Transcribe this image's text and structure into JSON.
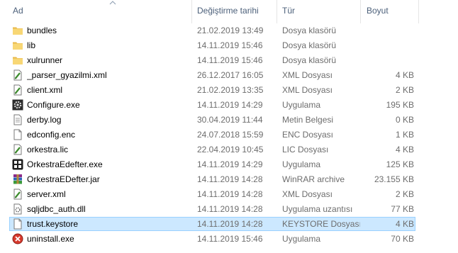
{
  "columns": {
    "name": "Ad",
    "date": "Değiştirme tarihi",
    "type": "Tür",
    "size": "Boyut"
  },
  "sort": {
    "column": "name",
    "direction": "ascending"
  },
  "files": [
    {
      "name": "bundles",
      "date": "21.02.2019 13:49",
      "type": "Dosya klasörü",
      "size": "",
      "icon": "folder-icon"
    },
    {
      "name": "lib",
      "date": "14.11.2019 15:46",
      "type": "Dosya klasörü",
      "size": "",
      "icon": "folder-icon"
    },
    {
      "name": "xulrunner",
      "date": "14.11.2019 15:46",
      "type": "Dosya klasörü",
      "size": "",
      "icon": "folder-icon"
    },
    {
      "name": "_parser_gyazilmi.xml",
      "date": "26.12.2017 16:05",
      "type": "XML Dosyası",
      "size": "4 KB",
      "icon": "xml-file-icon"
    },
    {
      "name": "client.xml",
      "date": "21.02.2019 13:35",
      "type": "XML Dosyası",
      "size": "2 KB",
      "icon": "xml-file-icon"
    },
    {
      "name": "Configure.exe",
      "date": "14.11.2019 14:29",
      "type": "Uygulama",
      "size": "195 KB",
      "icon": "gear-exe-icon"
    },
    {
      "name": "derby.log",
      "date": "30.04.2019 11:44",
      "type": "Metin Belgesi",
      "size": "0 KB",
      "icon": "text-file-icon"
    },
    {
      "name": "edconfig.enc",
      "date": "24.07.2018 15:59",
      "type": "ENC Dosyası",
      "size": "1 KB",
      "icon": "blank-file-icon"
    },
    {
      "name": "orkestra.lic",
      "date": "22.04.2019 10:45",
      "type": "LIC Dosyası",
      "size": "4 KB",
      "icon": "xml-file-icon"
    },
    {
      "name": "OrkestraEdefter.exe",
      "date": "14.11.2019 14:29",
      "type": "Uygulama",
      "size": "125 KB",
      "icon": "app-exe-icon"
    },
    {
      "name": "OrkestraEDefter.jar",
      "date": "14.11.2019 14:28",
      "type": "WinRAR archive",
      "size": "23.155 KB",
      "icon": "winrar-icon"
    },
    {
      "name": "server.xml",
      "date": "14.11.2019 14:28",
      "type": "XML Dosyası",
      "size": "2 KB",
      "icon": "xml-file-icon"
    },
    {
      "name": "sqljdbc_auth.dll",
      "date": "14.11.2019 14:28",
      "type": "Uygulama uzantısı",
      "size": "77 KB",
      "icon": "dll-file-icon"
    },
    {
      "name": "trust.keystore",
      "date": "14.11.2019 14:28",
      "type": "KEYSTORE Dosyası",
      "size": "4 KB",
      "icon": "blank-file-icon",
      "selected": true
    },
    {
      "name": "uninstall.exe",
      "date": "14.11.2019 15:46",
      "type": "Uygulama",
      "size": "70 KB",
      "icon": "uninstall-exe-icon"
    }
  ],
  "colors": {
    "header_text": "#4c607a",
    "detail_text": "#6d6d6d",
    "selection_bg": "#cce8ff",
    "selection_border": "#99d1ff",
    "folder": "#f8d775"
  }
}
